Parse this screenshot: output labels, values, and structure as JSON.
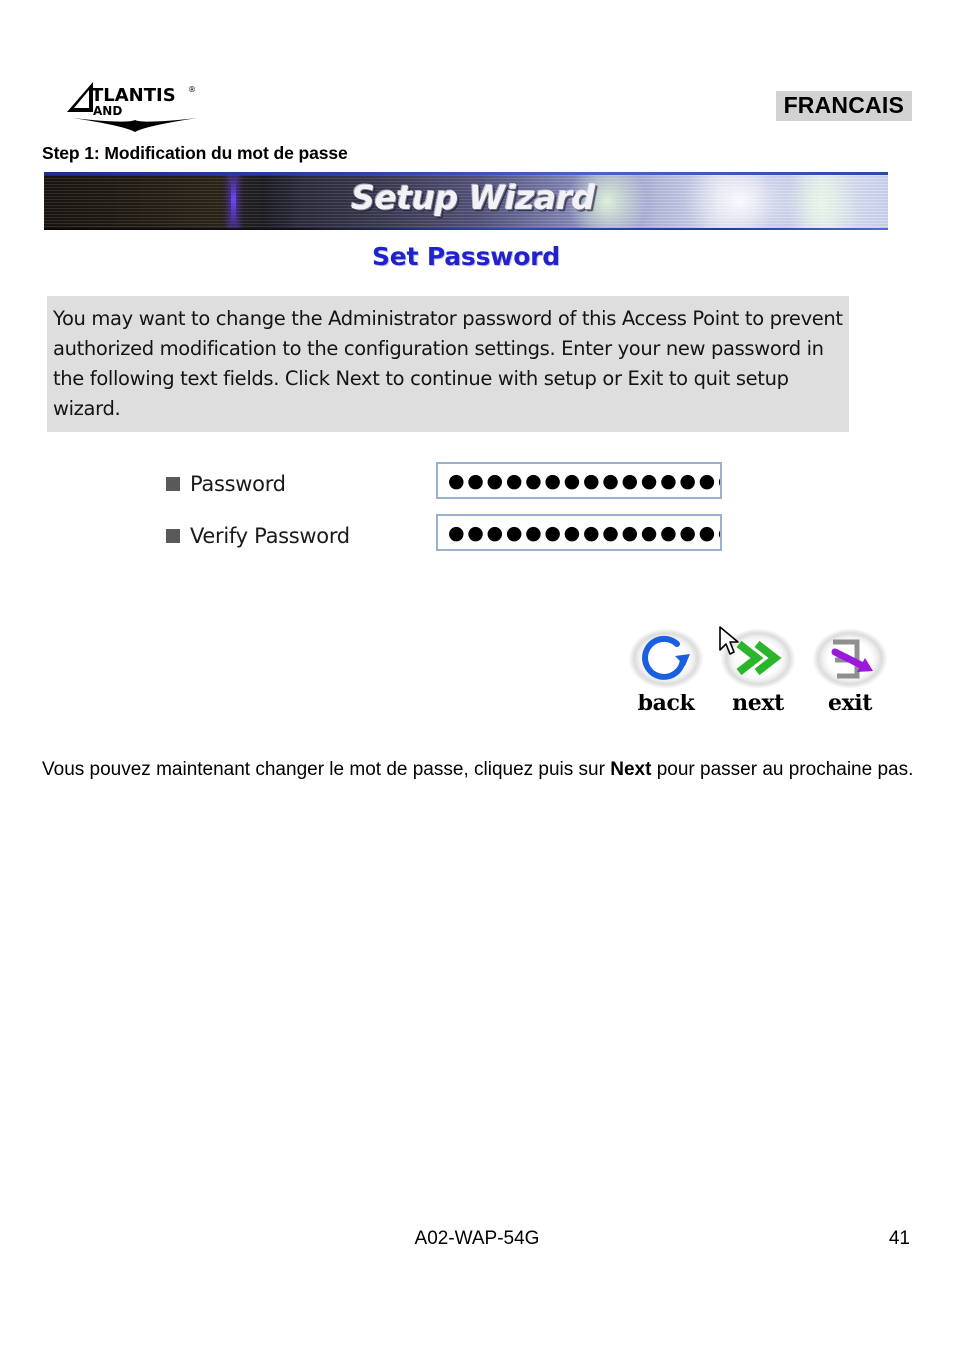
{
  "header": {
    "logo_primary": "ATLANTIS",
    "logo_secondary": "LAND",
    "logo_mark": "atlantis-land-logo",
    "language_badge": "FRANCAIS",
    "step_title": "Step 1: Modification du mot de passe"
  },
  "screenshot": {
    "banner_title": "Setup Wizard",
    "subtitle": "Set Password",
    "description": "You may want to change the Administrator password of this Access Point to prevent authorized modification to the configuration settings. Enter your new password in the following text fields. Click Next to continue with setup or Exit to quit setup wizard.",
    "fields": [
      {
        "label": "Password",
        "value": "●●●●●●●●●●●●●●●",
        "masked": true,
        "dot_count": 15
      },
      {
        "label": "Verify Password",
        "value": "●●●●●●●●●●●●●●●",
        "masked": true,
        "dot_count": 15
      }
    ],
    "buttons": [
      {
        "label": "back",
        "icon": "circular-arrow-icon",
        "color": "#1a5fe0"
      },
      {
        "label": "next",
        "icon": "double-chevron-right-icon",
        "color": "#2ab52a"
      },
      {
        "label": "exit",
        "icon": "exit-door-arrow-icon",
        "color": "#9b18dd"
      }
    ],
    "cursor_on_button": "next",
    "colors": {
      "subtitle": "#2222cc",
      "description_background": "#dedede",
      "input_border": "#9bb0cd",
      "bullet": "#595959"
    }
  },
  "body": {
    "paragraph_before": "Vous pouvez maintenant changer le mot de passe, cliquez puis sur ",
    "paragraph_bold": "Next",
    "paragraph_after": " pour passer au prochaine pas."
  },
  "footer": {
    "model": "A02-WAP-54G",
    "page_number": "41"
  }
}
